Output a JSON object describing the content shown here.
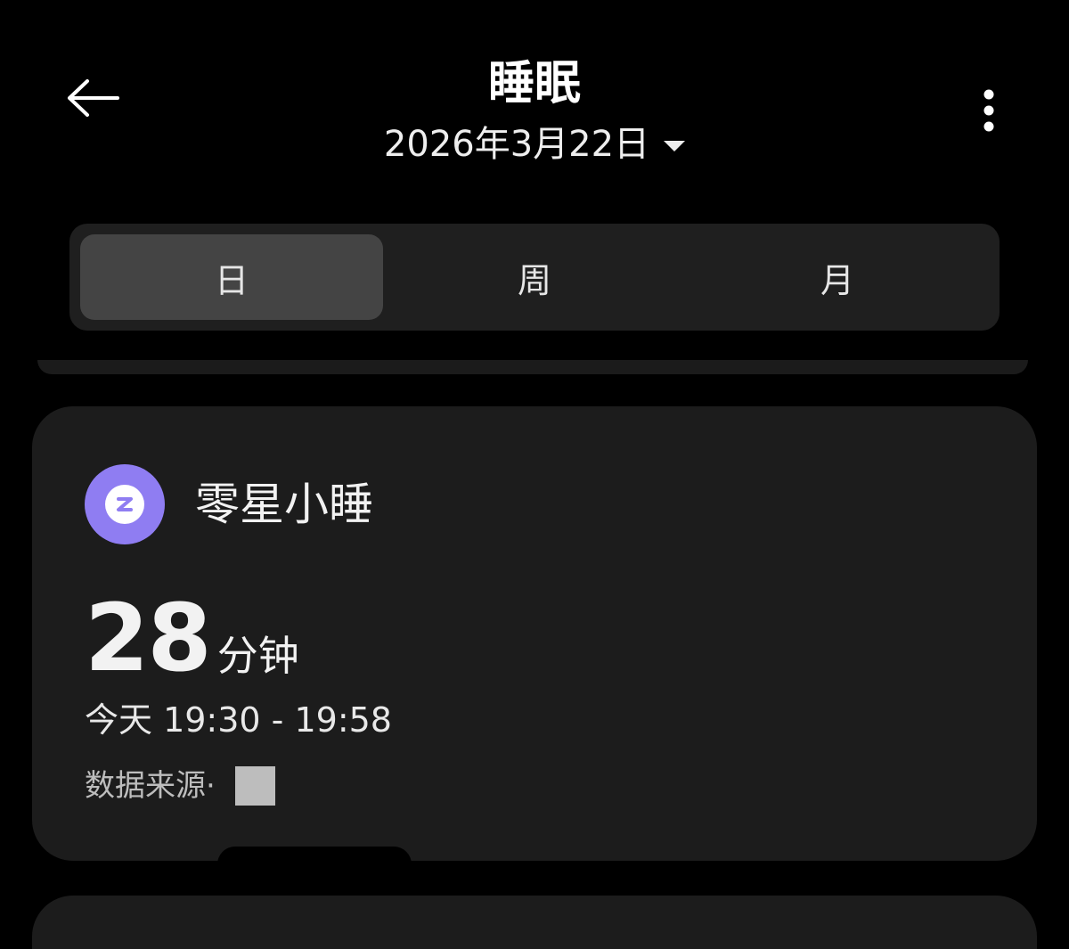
{
  "header": {
    "title": "睡眠",
    "date": "2026年3月22日",
    "back_icon": "arrow-left-icon",
    "more_icon": "more-vertical-icon",
    "date_caret_icon": "caret-down-icon"
  },
  "segmented": {
    "tabs": [
      {
        "label": "日",
        "active": true
      },
      {
        "label": "周",
        "active": false
      },
      {
        "label": "月",
        "active": false
      }
    ]
  },
  "nap_card": {
    "title": "零星小睡",
    "icon": "sleep-z-icon",
    "icon_color": "#8f7df2",
    "duration_value": "28",
    "duration_unit": "分钟",
    "time_range": "今天 19:30 - 19:58",
    "source_label": "数据来源·"
  }
}
